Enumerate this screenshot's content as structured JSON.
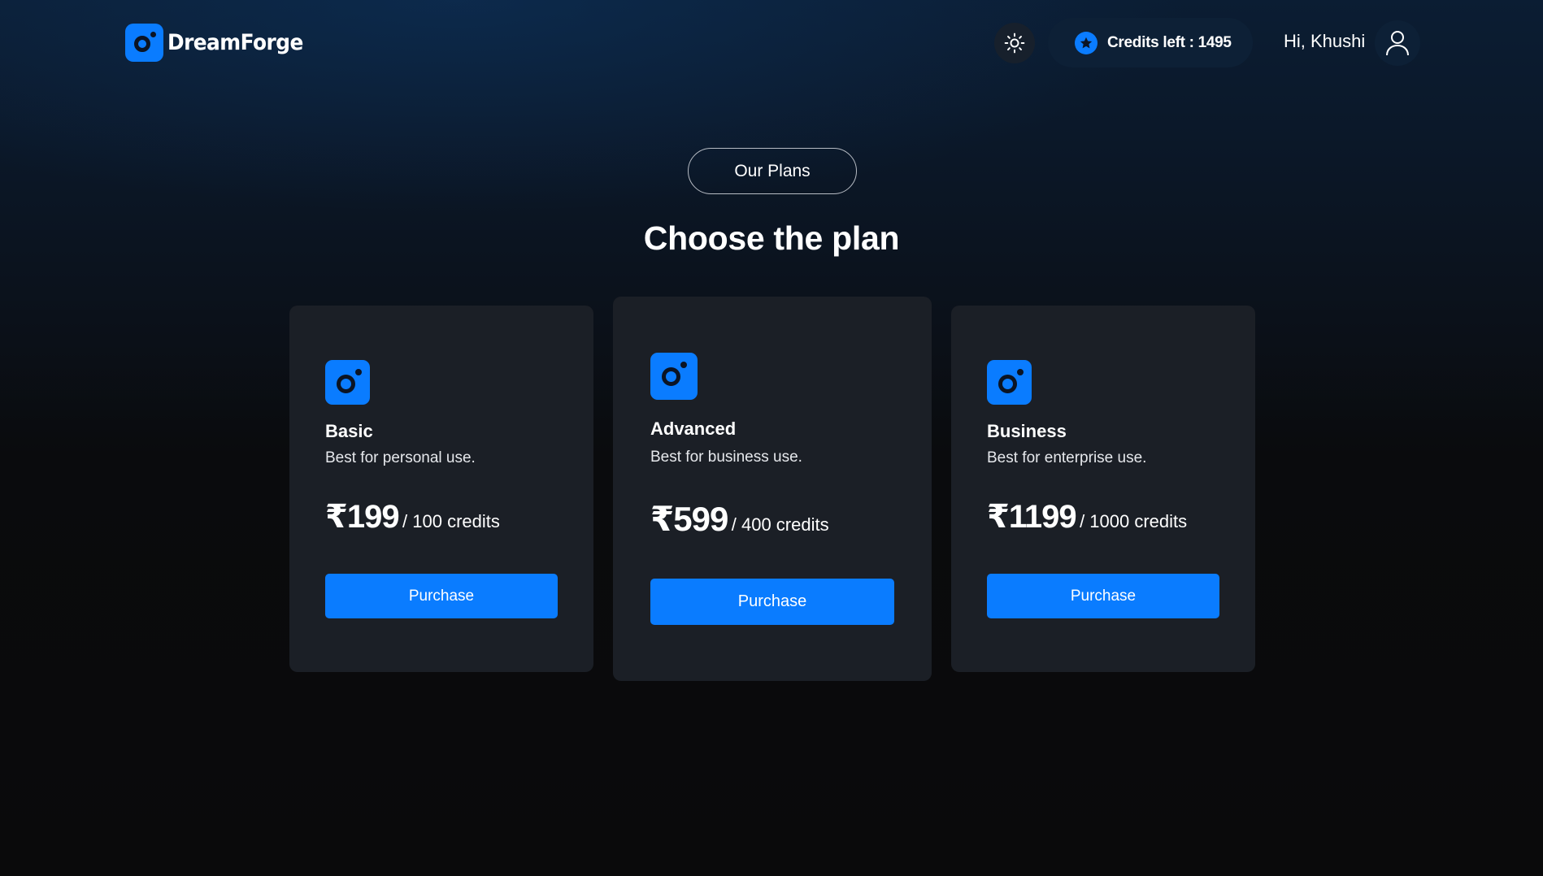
{
  "app": {
    "name": "DreamForge"
  },
  "header": {
    "theme_toggle_icon": "sun-icon",
    "credits_label": "Credits left : 1495",
    "credits_icon": "star-icon",
    "greeting": "Hi, Khushi",
    "avatar_icon": "user-icon"
  },
  "hero": {
    "badge": "Our Plans",
    "title": "Choose the plan"
  },
  "plans": [
    {
      "name": "Basic",
      "description": "Best for personal use.",
      "price": "₹199",
      "credits": "/ 100 credits",
      "button": "Purchase"
    },
    {
      "name": "Advanced",
      "description": "Best for business use.",
      "price": "₹599",
      "credits": "/ 400 credits",
      "button": "Purchase"
    },
    {
      "name": "Business",
      "description": "Best for enterprise use.",
      "price": "₹1199",
      "credits": "/ 1000 credits",
      "button": "Purchase"
    }
  ],
  "colors": {
    "accent": "#0a7cff",
    "card": "#1b1f26",
    "background": "#0a0a0b"
  }
}
